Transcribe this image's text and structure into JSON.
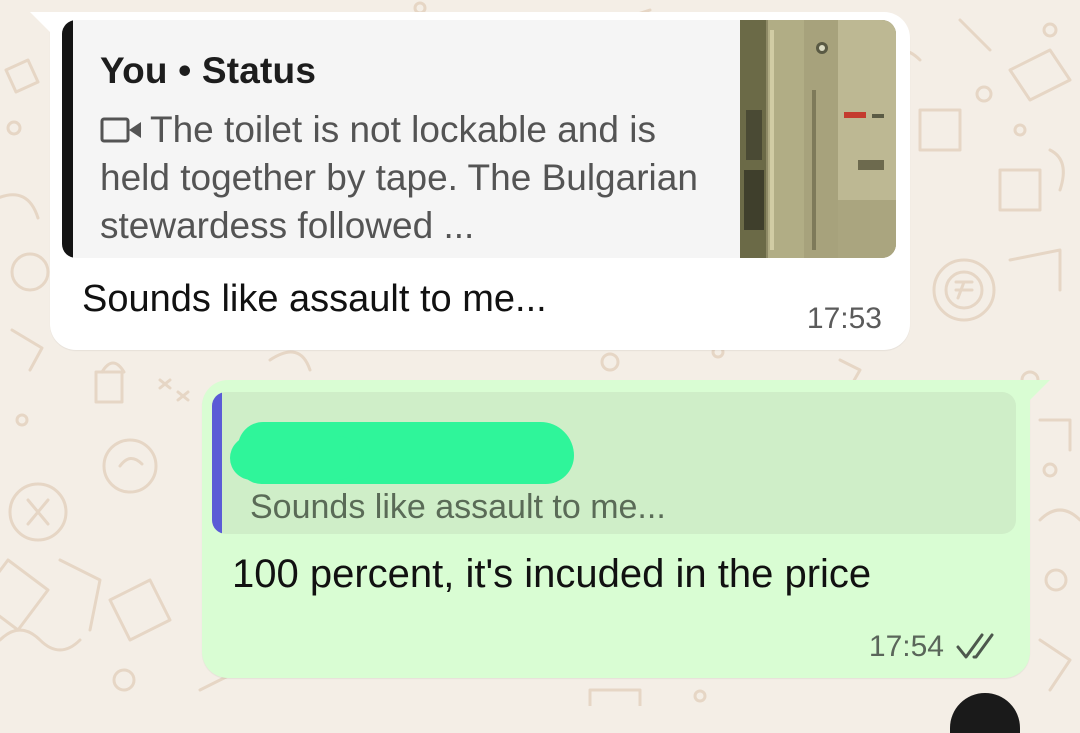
{
  "incoming": {
    "quote_author": "You • Status",
    "quote_icon": "video-icon",
    "quote_text": "The toilet is not lockable and is held together by tape. The Bulgarian stewardess followed ...",
    "message": "Sounds like assault to me...",
    "time": "17:53"
  },
  "outgoing": {
    "quote_author_redacted": true,
    "quote_text": "Sounds like assault to me...",
    "message": "100 percent, it's incuded in the price",
    "time": "17:54",
    "status_icon": "double-check-icon"
  },
  "colors": {
    "incoming_bubble": "#ffffff",
    "outgoing_bubble": "#d9fdd3",
    "quote_bar_incoming": "#141414",
    "quote_bar_outgoing": "#5b5bd6",
    "redaction": "#2ff59a",
    "wallpaper": "#f4eee6"
  }
}
